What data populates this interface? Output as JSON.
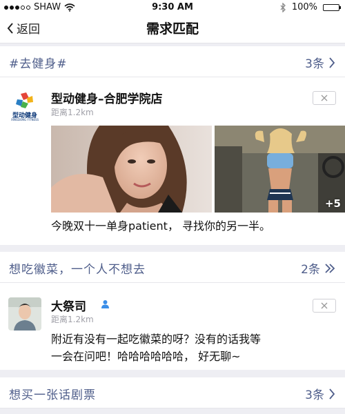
{
  "status_bar": {
    "carrier": "SHAW",
    "time": "9:30 AM",
    "battery": "100%",
    "signal_bars_filled": 3,
    "signal_bars_total": 5
  },
  "nav": {
    "back_label": "返回",
    "title": "需求匹配"
  },
  "sections": [
    {
      "title": "#去健身#",
      "count": "3条",
      "post": {
        "name": "型动健身–合肥学院店",
        "distance": "距离1.2km",
        "logo_text": "型动健身",
        "logo_subtext": "XINGDONG FITNESS",
        "photos_more": "+5",
        "text": "今晚双十一单身patient， 寻找你的另一半。"
      }
    },
    {
      "title": "想吃徽菜，一个人不想去",
      "count": "2条",
      "post": {
        "name": "大祭司",
        "distance": "距离1.2km",
        "text_line1": "附近有没有一起吃徽菜的呀？没有的话我等",
        "text_line2": "一会在问吧！哈哈哈哈哈哈， 好无聊~"
      }
    },
    {
      "title": "想买一张话剧票",
      "count": "3条"
    }
  ],
  "colors": {
    "section_text": "#4e5d8a",
    "background": "#eeeef3",
    "verified_icon": "#3b8ee8"
  }
}
